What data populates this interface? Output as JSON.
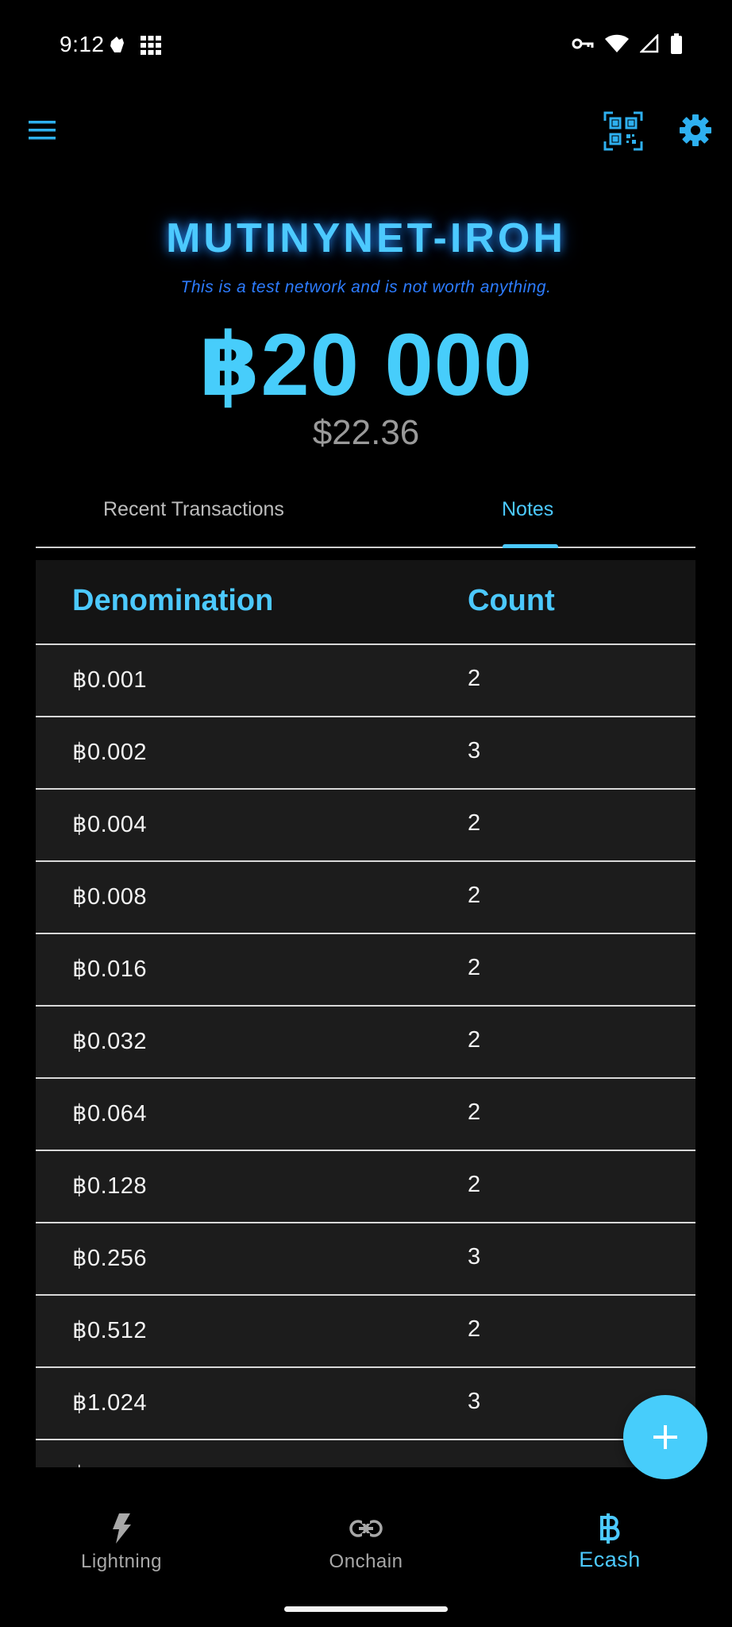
{
  "status_bar": {
    "time": "9:12"
  },
  "header": {
    "network_name": "MUTINYNET-IROH",
    "warning": "This is a test network and is not worth anything."
  },
  "balance": {
    "amount": "฿20 000",
    "fiat": "$22.36"
  },
  "tabs": [
    {
      "label": "Recent Transactions",
      "active": false
    },
    {
      "label": "Notes",
      "active": true
    }
  ],
  "notes_table": {
    "headers": [
      "Denomination",
      "Count"
    ],
    "rows": [
      {
        "denomination": "฿0.001",
        "count": "2"
      },
      {
        "denomination": "฿0.002",
        "count": "3"
      },
      {
        "denomination": "฿0.004",
        "count": "2"
      },
      {
        "denomination": "฿0.008",
        "count": "2"
      },
      {
        "denomination": "฿0.016",
        "count": "2"
      },
      {
        "denomination": "฿0.032",
        "count": "2"
      },
      {
        "denomination": "฿0.064",
        "count": "2"
      },
      {
        "denomination": "฿0.128",
        "count": "2"
      },
      {
        "denomination": "฿0.256",
        "count": "3"
      },
      {
        "denomination": "฿0.512",
        "count": "2"
      },
      {
        "denomination": "฿1.024",
        "count": "3"
      },
      {
        "denomination": "฿",
        "count": ""
      }
    ]
  },
  "bottom_nav": [
    {
      "label": "Lightning",
      "icon": "lightning-icon",
      "active": false
    },
    {
      "label": "Onchain",
      "icon": "link-icon",
      "active": false
    },
    {
      "label": "Ecash",
      "icon": "bitcoin-icon",
      "active": true
    }
  ],
  "colors": {
    "accent": "#4cc9ff",
    "warning": "#2d7cff",
    "background": "#000000",
    "table_row": "#1c1c1c",
    "inactive": "#a8a8a8"
  }
}
